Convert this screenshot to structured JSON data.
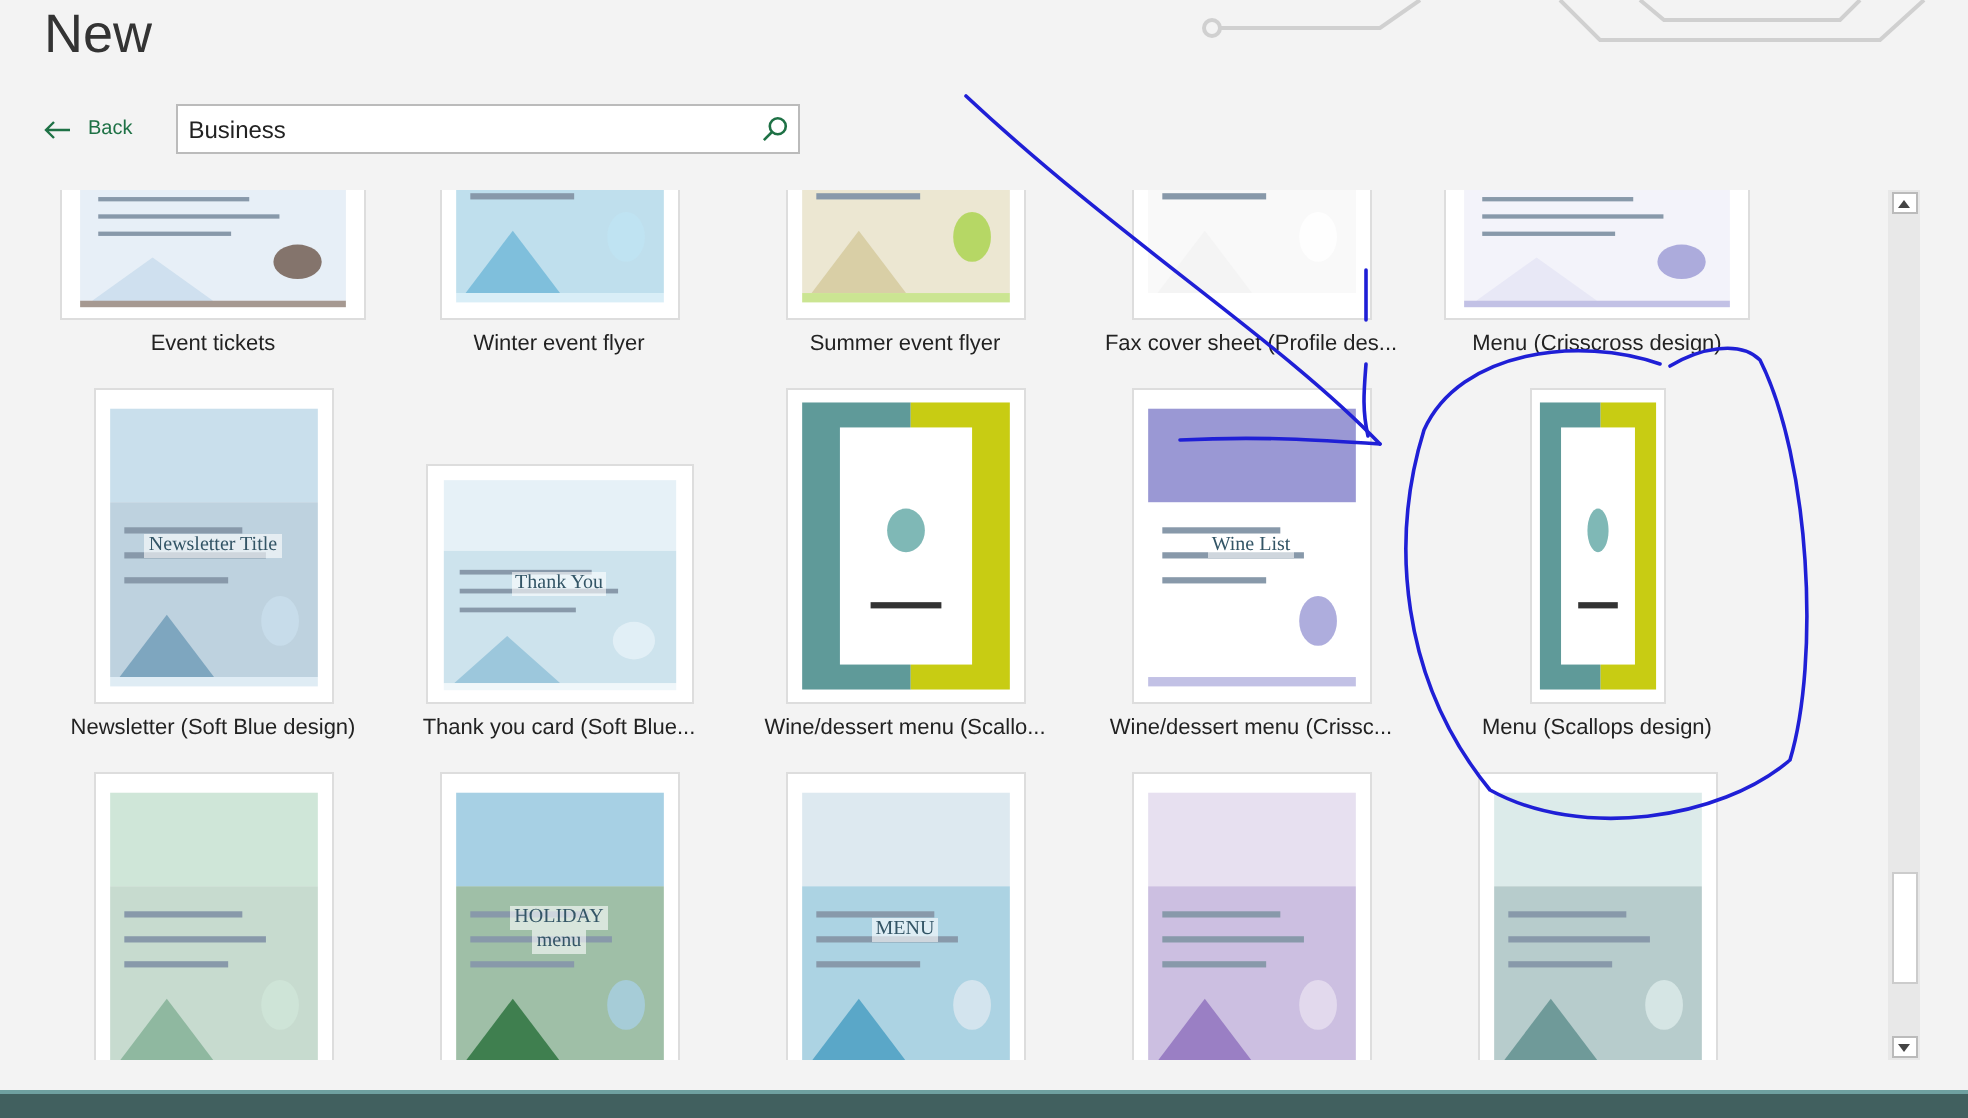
{
  "page": {
    "title": "New"
  },
  "back": {
    "label": "Back"
  },
  "search": {
    "value": "Business"
  },
  "templates": [
    {
      "name": "Event tickets",
      "kind": "landscape"
    },
    {
      "name": "Winter event flyer",
      "kind": "portrait"
    },
    {
      "name": "Summer event flyer",
      "kind": "portrait"
    },
    {
      "name": "Fax cover sheet (Profile des...",
      "kind": "portrait"
    },
    {
      "name": "Menu (Crisscross design)",
      "kind": "landscape"
    },
    {
      "name": "Newsletter (Soft Blue design)",
      "kind": "portrait",
      "text": [
        "Newsletter Title"
      ]
    },
    {
      "name": "Thank you card (Soft Blue...",
      "kind": "card",
      "text": [
        "Thank You"
      ]
    },
    {
      "name": "Wine/dessert menu (Scallo...",
      "kind": "portrait"
    },
    {
      "name": "Wine/dessert menu (Crissc...",
      "kind": "portrait",
      "text": [
        "Wine List"
      ]
    },
    {
      "name": "Menu (Scallops design)",
      "kind": "narrow"
    },
    {
      "kind": "portrait"
    },
    {
      "kind": "portrait",
      "text": [
        "HOLIDAY",
        "menu"
      ]
    },
    {
      "kind": "portrait",
      "text": [
        "MENU"
      ]
    },
    {
      "kind": "portrait"
    },
    {
      "kind": "portrait"
    }
  ]
}
